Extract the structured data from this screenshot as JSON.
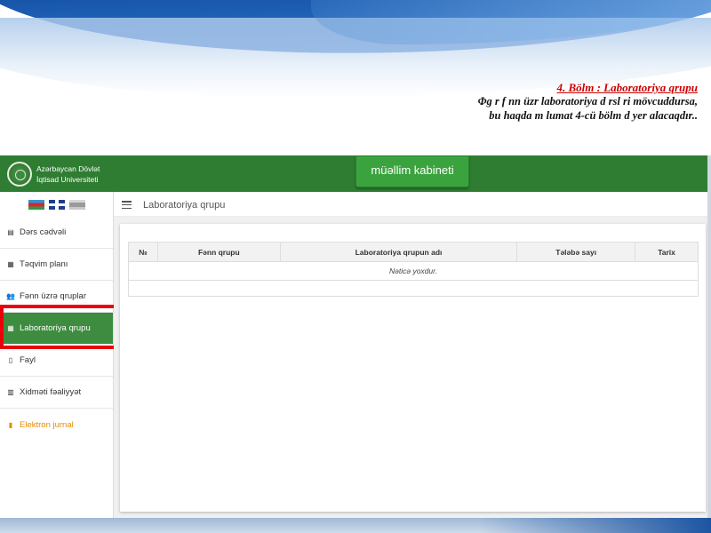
{
  "slide": {
    "title": "4. Bölm : Laboratoriya qrupu",
    "text_line1": "Φg r f nn üzr laboratoriya d rsl ri mövcuddursa,",
    "text_line2": "bu haqda m lumat 4-cü bölm d yer alacaqdır.."
  },
  "header": {
    "university_line1": "Azərbaycan Dövlət",
    "university_line2": "İqtisad Universiteti",
    "cabinet_button": "müəllim kabineti",
    "accent_color": "#2e7d32"
  },
  "languages": [
    "az-flag-icon",
    "uk-flag-icon",
    "ru-flag-icon"
  ],
  "sidebar": {
    "items": [
      {
        "label": "Dərs cədvəli",
        "icon": "book-icon",
        "glyph": "▤"
      },
      {
        "label": "Təqvim planı",
        "icon": "calendar-icon",
        "glyph": "▦"
      },
      {
        "label": "Fənn üzrə qruplar",
        "icon": "users-icon",
        "glyph": "👥"
      },
      {
        "label": "Laboratoriya qrupu",
        "icon": "table-icon",
        "glyph": "▦"
      },
      {
        "label": "Fayl",
        "icon": "file-icon",
        "glyph": "▯"
      },
      {
        "label": "Xidməti fəaliyyət",
        "icon": "bar-chart-icon",
        "glyph": "▥"
      },
      {
        "label": "Elektron jurnal",
        "icon": "document-icon",
        "glyph": "▮"
      }
    ],
    "active_index": 3,
    "highlight_color": "#e8000a"
  },
  "topbar": {
    "breadcrumb": "Laboratoriya qrupu"
  },
  "table": {
    "columns": [
      "№",
      "Fənn qrupu",
      "Laboratoriya qrupun adı",
      "Tələbə sayı",
      "Tarix"
    ],
    "empty_message": "Nəticə yoxdur."
  }
}
